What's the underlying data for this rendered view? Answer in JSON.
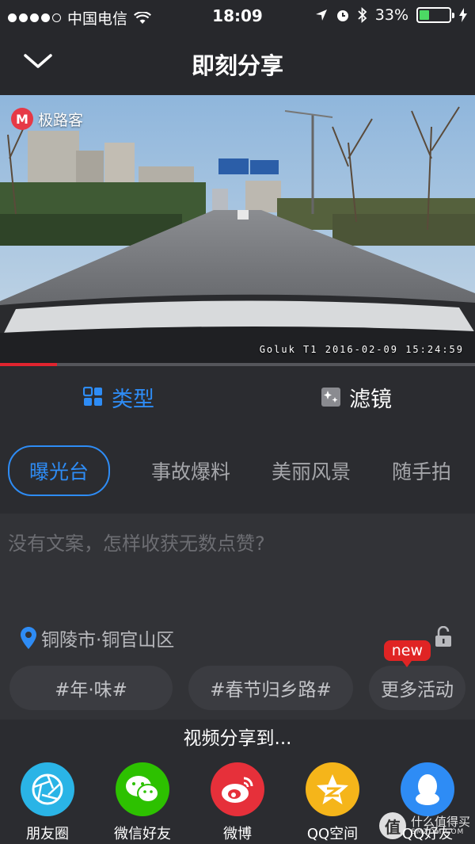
{
  "status_bar": {
    "carrier": "中国电信",
    "time": "18:09",
    "battery": "33%",
    "battery_level": 0.33
  },
  "nav": {
    "title": "即刻分享",
    "back_icon": "chevron-down-icon"
  },
  "video": {
    "logo_text": "极路客",
    "logo_mark": "M",
    "timestamp": "Goluk T1 2016-02-09 15:24:59",
    "progress": 0.12
  },
  "mode_tabs": [
    {
      "label": "类型",
      "icon": "grid-icon",
      "active": true
    },
    {
      "label": "滤镜",
      "icon": "sparkle-icon",
      "active": false
    }
  ],
  "categories": [
    "曝光台",
    "事故爆料",
    "美丽风景",
    "随手拍"
  ],
  "selected_category": "曝光台",
  "compose": {
    "placeholder": "没有文案，怎样收获无数点赞?",
    "location": "铜陵市·铜官山区"
  },
  "activities": {
    "chips": [
      "#年·味#",
      "#春节归乡路#",
      "更多活动"
    ],
    "badge": "new"
  },
  "share": {
    "title": "视频分享到...",
    "targets": [
      {
        "label": "朋友圈",
        "icon": "aperture-icon",
        "color": "#2ab4e6"
      },
      {
        "label": "微信好友",
        "icon": "wechat-icon",
        "color": "#2dc100"
      },
      {
        "label": "微博",
        "icon": "weibo-icon",
        "color": "#e6303a"
      },
      {
        "label": "QQ空间",
        "icon": "qzone-star-icon",
        "color": "#f5b51a"
      },
      {
        "label": "QQ好友",
        "icon": "qq-penguin-icon",
        "color": "#2e8cf5"
      }
    ]
  },
  "watermark": {
    "mark": "值",
    "text": "什么值得买",
    "sub": "SMZDM.COM"
  },
  "colors": {
    "accent": "#2e8cf5",
    "background": "#2b2c30",
    "progress": "#e0242f"
  }
}
